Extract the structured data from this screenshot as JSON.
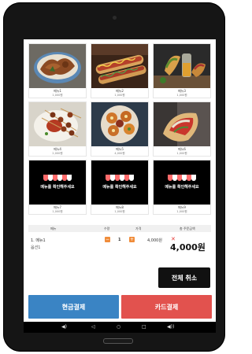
{
  "menu_items": [
    {
      "name": "메뉴1",
      "price": "1,000원",
      "image": "food-photo-chicken"
    },
    {
      "name": "메뉴2",
      "price": "1,000원",
      "image": "food-photo-hotdogs"
    },
    {
      "name": "메뉴3",
      "price": "1,000원",
      "image": "food-photo-tacos"
    },
    {
      "name": "메뉴4",
      "price": "2,000원",
      "image": "food-photo-skewers"
    },
    {
      "name": "메뉴5",
      "price": "4,000원",
      "image": "food-photo-platter"
    },
    {
      "name": "메뉴6",
      "price": "1,000원",
      "image": "food-photo-wrap"
    },
    {
      "name": "메뉴7",
      "price": "1,000원",
      "image": "placeholder"
    },
    {
      "name": "메뉴8",
      "price": "1,000원",
      "image": "placeholder"
    },
    {
      "name": "메뉴9",
      "price": "1,000원",
      "image": "placeholder"
    }
  ],
  "placeholder_text": "메뉴를 확인해주세요",
  "order_table": {
    "headers": {
      "menu": "메뉴",
      "qty": "수량",
      "price": "가격",
      "total": "총 주문금액"
    }
  },
  "order_line": {
    "name": "1. 메뉴1",
    "qty": "1",
    "price": "4,000원",
    "option": "옵션1",
    "minus": "−",
    "plus": "+",
    "delete": "✕"
  },
  "total": "4,000원",
  "buttons": {
    "cancel_all": "전체 취소",
    "cash": "현금결제",
    "card": "카드결제"
  },
  "nav_icons": [
    "volume-down-icon",
    "back-icon",
    "home-icon",
    "recents-icon",
    "volume-up-icon"
  ],
  "colors": {
    "cash": "#3a84c4",
    "card": "#e2524e",
    "qty_button": "#f08c3a",
    "delete": "#e53935"
  }
}
